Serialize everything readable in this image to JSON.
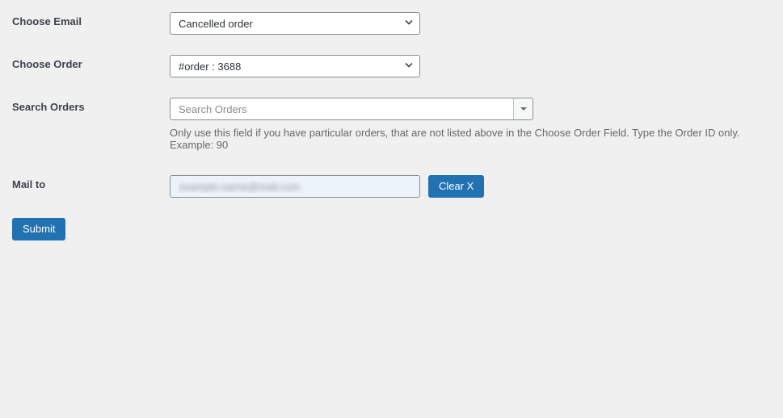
{
  "labels": {
    "choose_email": "Choose Email",
    "choose_order": "Choose Order",
    "search_orders": "Search Orders",
    "mail_to": "Mail to"
  },
  "choose_email": {
    "selected": "Cancelled order"
  },
  "choose_order": {
    "selected": "#order : 3688"
  },
  "search_orders": {
    "placeholder": "Search Orders",
    "hint": "Only use this field if you have particular orders, that are not listed above in the Choose Order Field. Type the Order ID only. Example: 90"
  },
  "mail_to": {
    "value": "example.name@mail.com"
  },
  "buttons": {
    "clear": "Clear X",
    "submit": "Submit"
  }
}
